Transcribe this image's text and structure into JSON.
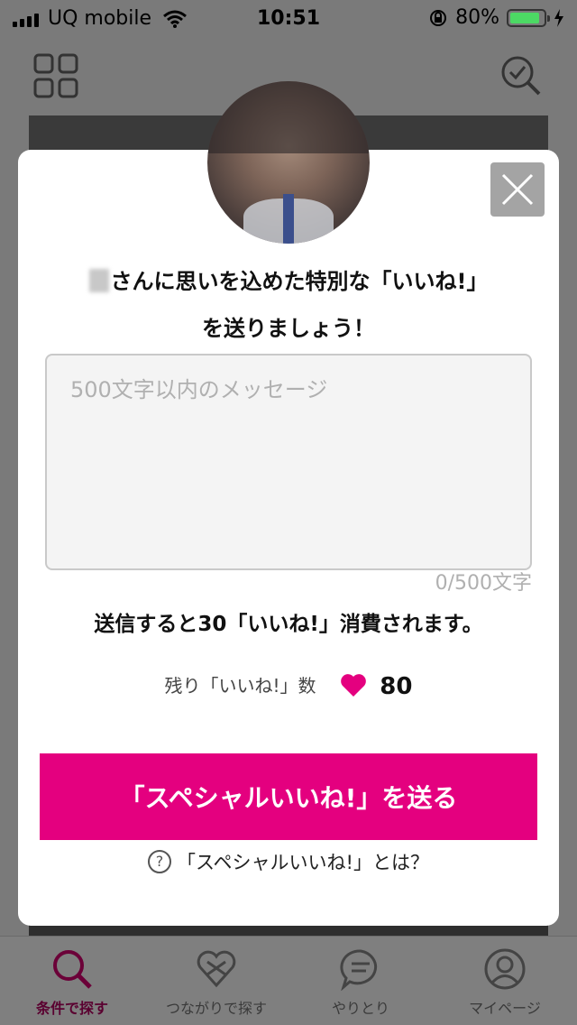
{
  "status_bar": {
    "carrier": "UQ mobile",
    "time": "10:51",
    "battery_percent": "80%",
    "battery_level": 0.8
  },
  "modal": {
    "headline_line1": "さんに思いを込めた特別な「いいね!」",
    "headline_line2": "を送りましょう！",
    "message_placeholder": "500文字以内のメッセージ",
    "char_counter": "0/500文字",
    "consume_text": "送信すると30「いいね!」消費されます。",
    "remaining_label": "残り「いいね!」数",
    "remaining_count": "80",
    "send_button_label": "「スペシャルいいね!」を送る",
    "help_icon_glyph": "?",
    "help_link_label": "「スペシャルいいね!」とは？",
    "accent_color": "#e4007f"
  },
  "tab_bar": {
    "tabs": [
      {
        "label": "条件で探す",
        "icon": "search-icon",
        "active": true
      },
      {
        "label": "つながりで探す",
        "icon": "heart-connect-icon",
        "active": false
      },
      {
        "label": "やりとり",
        "icon": "chat-icon",
        "active": false
      },
      {
        "label": "マイページ",
        "icon": "user-icon",
        "active": false
      }
    ]
  },
  "icons": {
    "top_left": "grid-icon",
    "top_right": "search-check-icon",
    "modal_close": "close-icon"
  }
}
